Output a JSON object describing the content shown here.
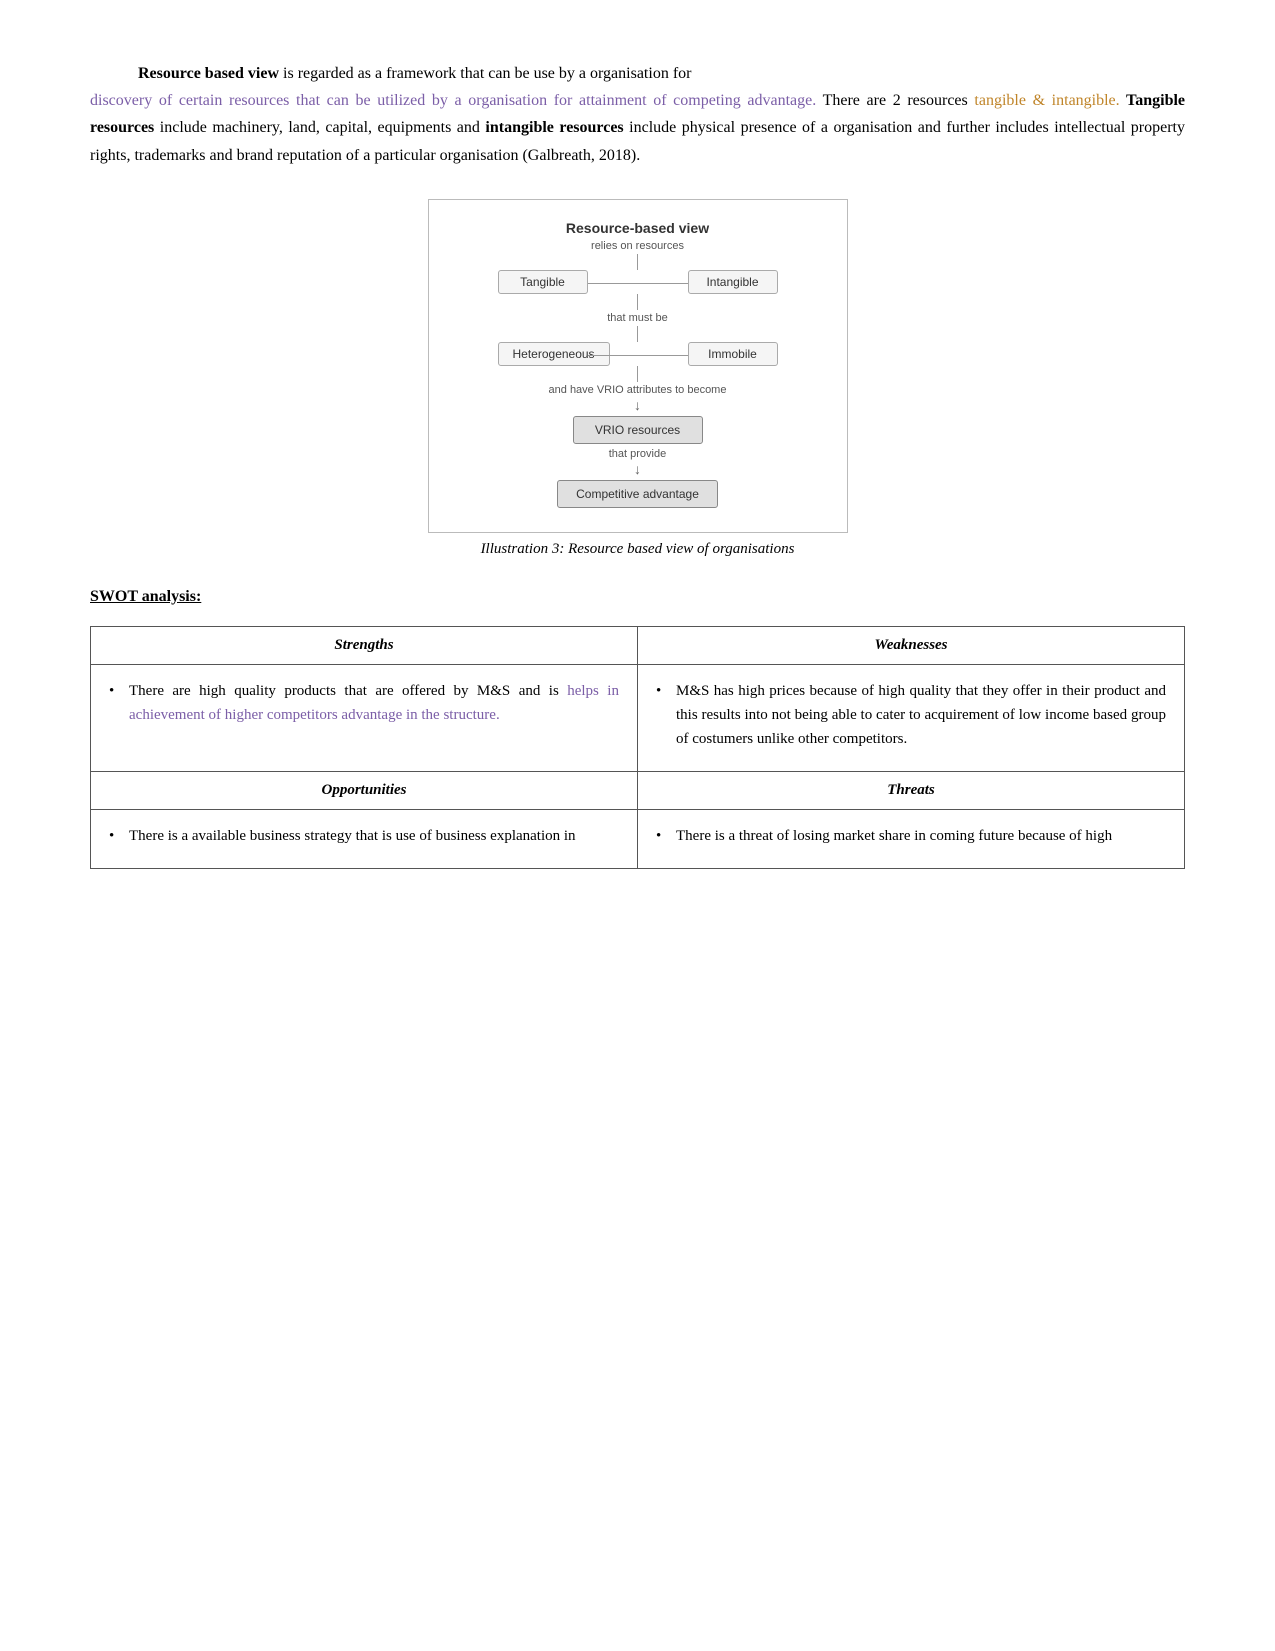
{
  "paragraph1": {
    "intro_bold": "Resource based view",
    "intro_rest": " is regarded as a framework that can be use by a organisation for",
    "purple_text": "discovery of certain resources that can be utilized by a organisation for attainment of competing advantage.",
    "middle": " There are 2  resources ",
    "orange_text": "tangible &  intangible.",
    "bold_tangible": " Tangible resources",
    "tangible_rest": " include machinery, land, capital, equipments and",
    "bold_intangible": " intangible resources",
    "intangible_rest": " include physical presence of a organisation and further includes intellectual property rights, trademarks and brand reputation of a particular organisation (Galbreath,  2018)."
  },
  "diagram": {
    "title": "Resource-based view",
    "line1": "relies on resources",
    "box_tangible": "Tangible",
    "box_intangible": "Intangible",
    "line2": "that must be",
    "box_hetero": "Heterogeneous",
    "box_immobile": "Immobile",
    "line3": "and have VRIO attributes to become",
    "box_vrio": "VRIO resources",
    "line4": "that provide",
    "box_competitive": "Competitive advantage"
  },
  "caption": "Illustration 3: Resource  based view of organisations",
  "swot_heading": "SWOT analysis:",
  "swot": {
    "strengths_header": "Strengths",
    "weaknesses_header": "Weaknesses",
    "opportunities_header": "Opportunities",
    "threats_header": "Threats",
    "strengths_item1_black1": "There are high quality products that are offered by M&S and is ",
    "strengths_item1_purple": "helps in achievement of higher competitors advantage in the structure.",
    "weaknesses_item1": "M&S has high prices because of high quality that they offer in their product and this results into not being able to cater to acquirement of low income based group of costumers unlike other competitors.",
    "opportunities_item1_black1": "There is a available business strategy that is use of business explanation in",
    "threats_item1_black1": "There is a threat of losing market share in coming future because of high"
  }
}
